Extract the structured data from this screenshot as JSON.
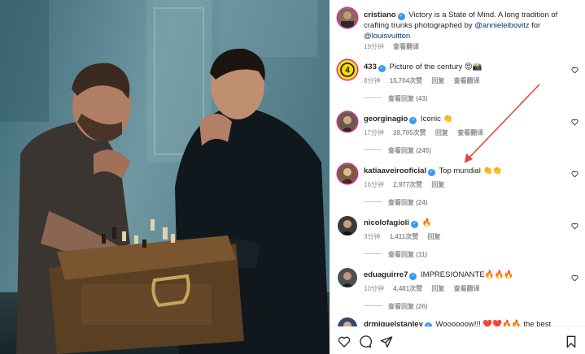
{
  "post": {
    "author": "cristiano",
    "caption": "Victory is a State of Mind. A long tradition of crafting trunks photographed by ",
    "mention1": "@annieleibovitz",
    "for_word": " for",
    "mention2": "@louisvuitton",
    "time": "19分钟",
    "translate": "查看翻译"
  },
  "comments": [
    {
      "user": "433",
      "text": "Picture of the century 😍📸",
      "time": "8分钟",
      "likes": "15,704次赞",
      "reply": "回复",
      "translate": "查看翻译",
      "replies": "查看回复 (43)",
      "avatar_color": "#f5d90a"
    },
    {
      "user": "georginagio",
      "text": "Iconic 👏",
      "time": "17分钟",
      "likes": "28,705次赞",
      "reply": "回复",
      "translate": "查看翻译",
      "replies": "查看回复 (245)",
      "avatar_color": "#6b5a4a"
    },
    {
      "user": "katiaaveirooficial",
      "text": "Top mundial 👏👏",
      "time": "16分钟",
      "likes": "2,977次赞",
      "reply": "回复",
      "translate": "",
      "replies": "查看回复 (24)",
      "avatar_color": "#7a5c3e"
    },
    {
      "user": "nicolofagioli",
      "text": "🔥",
      "time": "3分钟",
      "likes": "1,411次赞",
      "reply": "回复",
      "translate": "",
      "replies": "查看回复 (11)",
      "avatar_color": "#3a3a3a"
    },
    {
      "user": "eduaguirre7",
      "text": "IMPRESIONANTE🔥🔥🔥",
      "time": "10分钟",
      "likes": "4,481次赞",
      "reply": "回复",
      "translate": "查看翻译",
      "replies": "查看回复 (26)",
      "avatar_color": "#4a4f55"
    },
    {
      "user": "drmiguelstanley",
      "text": "Woooooow!!! ❤️❤️🔥🔥 the best photo",
      "time": "",
      "likes": "",
      "reply": "",
      "translate": "",
      "replies": "",
      "avatar_color": "#2f4a6b"
    }
  ],
  "badge_433": "4",
  "colors": {
    "verified": "#3897f0",
    "annotation_arrow": "#e8453c",
    "story_ring": "#d6249f"
  },
  "icons": {
    "like": "heart-icon",
    "comment": "comment-icon",
    "share": "send-icon",
    "save": "bookmark-icon"
  }
}
